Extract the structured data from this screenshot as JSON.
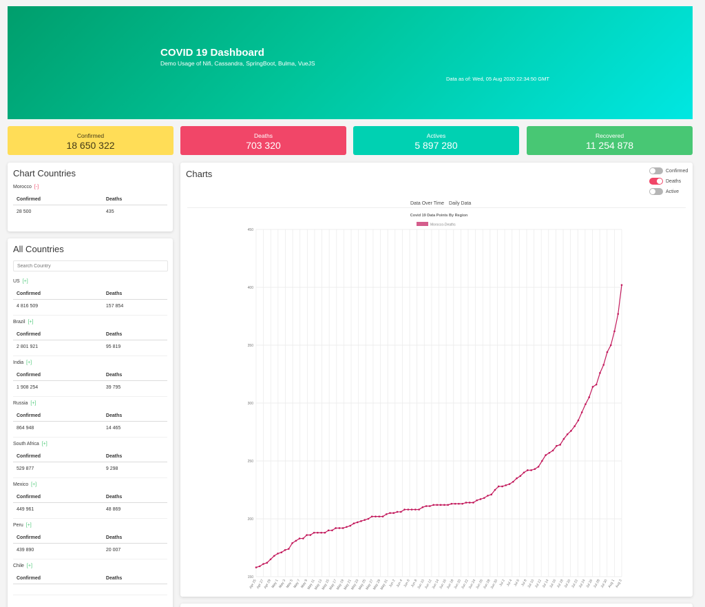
{
  "hero": {
    "title": "COVID 19 Dashboard",
    "subtitle": "Demo Usage of Nifi, Cassandra, SpringBoot, Bulma, VueJS",
    "as_of": "Data as of: Wed, 05 Aug 2020 22:34:50 GMT"
  },
  "stats": {
    "confirmed": {
      "label": "Confirmed",
      "value": "18 650 322"
    },
    "deaths": {
      "label": "Deaths",
      "value": "703 320"
    },
    "actives": {
      "label": "Actives",
      "value": "5 897 280"
    },
    "recovered": {
      "label": "Recovered",
      "value": "11 254 878"
    }
  },
  "chart_countries": {
    "title": "Chart Countries",
    "country": "Morocco",
    "toggle": "[-]",
    "col_confirmed": "Confirmed",
    "col_deaths": "Deaths",
    "confirmed": "28 500",
    "deaths": "435"
  },
  "all_countries": {
    "title": "All Countries",
    "search_placeholder": "Search Country",
    "toggle": "[+]",
    "col_confirmed": "Confirmed",
    "col_deaths": "Deaths",
    "countries": [
      {
        "name": "US",
        "confirmed": "4 816 509",
        "deaths": "157 854"
      },
      {
        "name": "Brazil",
        "confirmed": "2 801 921",
        "deaths": "95 819"
      },
      {
        "name": "India",
        "confirmed": "1 908 254",
        "deaths": "39 795"
      },
      {
        "name": "Russia",
        "confirmed": "864 948",
        "deaths": "14 465"
      },
      {
        "name": "South Africa",
        "confirmed": "529 877",
        "deaths": "9 298"
      },
      {
        "name": "Mexico",
        "confirmed": "449 961",
        "deaths": "48 869"
      },
      {
        "name": "Peru",
        "confirmed": "439 890",
        "deaths": "20 007"
      },
      {
        "name": "Chile",
        "confirmed": "",
        "deaths": ""
      }
    ]
  },
  "charts_panel": {
    "title": "Charts",
    "switches": [
      {
        "label": "Confirmed",
        "on": false
      },
      {
        "label": "Deaths",
        "on": true
      },
      {
        "label": "Active",
        "on": false
      }
    ],
    "tabs": [
      "Data Over Time",
      "Daily Data"
    ]
  },
  "chart_data": {
    "type": "line",
    "title": "Covid 19 Data Points By Region",
    "ylim": [
      150,
      450
    ],
    "yticks": [
      150,
      200,
      250,
      300,
      350,
      400,
      450
    ],
    "grid": true,
    "legend": "top",
    "series_color": "#c2185b",
    "x_tick_labels": [
      "Apr 25",
      "Apr 27",
      "Apr 29",
      "May 1",
      "May 3",
      "May 5",
      "May 7",
      "May 9",
      "May 11",
      "May 13",
      "May 15",
      "May 17",
      "May 19",
      "May 21",
      "May 23",
      "May 25",
      "May 27",
      "May 29",
      "May 31",
      "Jun 2",
      "Jun 4",
      "Jun 6",
      "Jun 8",
      "Jun 10",
      "Jun 12",
      "Jun 14",
      "Jun 16",
      "Jun 18",
      "Jun 20",
      "Jun 22",
      "Jun 24",
      "Jun 26",
      "Jun 28",
      "Jun 30",
      "Jul 2",
      "Jul 4",
      "Jul 6",
      "Jul 8",
      "Jul 10",
      "Jul 12",
      "Jul 14",
      "Jul 16",
      "Jul 18",
      "Jul 20",
      "Jul 22",
      "Jul 24",
      "Jul 26",
      "Jul 28",
      "Jul 30",
      "Aug 1",
      "Aug 3"
    ],
    "series": [
      {
        "name": "Morocco-Deaths",
        "values": [
          158,
          159,
          161,
          162,
          165,
          168,
          170,
          171,
          173,
          174,
          179,
          181,
          183,
          183,
          186,
          186,
          188,
          188,
          188,
          188,
          190,
          190,
          192,
          192,
          192,
          193,
          194,
          196,
          197,
          198,
          199,
          200,
          202,
          202,
          202,
          202,
          204,
          205,
          205,
          206,
          206,
          208,
          208,
          208,
          208,
          208,
          210,
          211,
          211,
          212,
          212,
          212,
          212,
          212,
          213,
          213,
          213,
          213,
          214,
          214,
          214,
          216,
          217,
          218,
          220,
          221,
          225,
          228,
          228,
          229,
          230,
          232,
          235,
          237,
          240,
          242,
          242,
          243,
          245,
          250,
          255,
          257,
          259,
          263,
          264,
          269,
          273,
          276,
          280,
          285,
          292,
          299,
          305,
          314,
          316,
          326,
          333,
          344,
          350,
          362,
          377,
          402
        ]
      }
    ]
  }
}
